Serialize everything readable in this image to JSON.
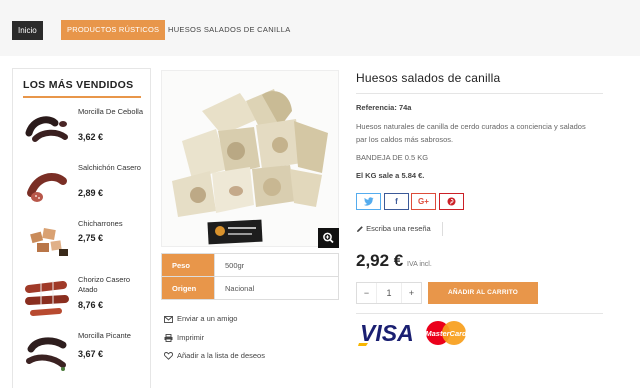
{
  "breadcrumb": {
    "home": "Inicio",
    "category": "PRODUCTOS RÚSTICOS",
    "current": "HUESOS SALADOS DE CANILLA"
  },
  "sidebar": {
    "title": "LOS MÁS VENDIDOS",
    "items": [
      {
        "name": "Morcilla De Cebolla",
        "price": "3,62 €"
      },
      {
        "name": "Salchichón Casero",
        "price": "2,89 €"
      },
      {
        "name": "Chicharrones",
        "price": "2,75 €"
      },
      {
        "name": "Chorizo Casero Atado",
        "price": "8,76 €"
      },
      {
        "name": "Morcilla Picante",
        "price": "3,67 €"
      }
    ]
  },
  "product": {
    "title": "Huesos salados de canilla",
    "reference_label": "Referencia:",
    "reference": "74a",
    "description": "Huesos naturales de canilla de cerdo curados a conciencia y salados par los caldos más sabrosos.",
    "package": "BANDEJA DE 0.5 KG",
    "kg_price": "El KG sale a 5.84 €.",
    "review_link": "Escriba una reseña",
    "price": "2,92 €",
    "tax_note": "IVA incl.",
    "quantity": "1",
    "add_to_cart": "AÑADIR AL CARRITO",
    "qty_minus": "−",
    "qty_plus": "+"
  },
  "share": {
    "twitter": "t",
    "facebook": "f",
    "google": "G+",
    "pinterest": "P"
  },
  "attributes": [
    {
      "key": "Peso",
      "value": "500gr"
    },
    {
      "key": "Origen",
      "value": "Nacional"
    }
  ],
  "actions": {
    "send_friend": "Enviar a un amigo",
    "print": "Imprimir",
    "wishlist": "Añadir a la lista de deseos"
  },
  "payment": {
    "visa": "VISA",
    "mastercard": "MasterCard"
  },
  "colors": {
    "accent": "#e8964a",
    "dark": "#2b2b2b",
    "twitter": "#55acee",
    "facebook": "#3b5998",
    "google": "#dd4b39",
    "pinterest": "#cb2027"
  }
}
